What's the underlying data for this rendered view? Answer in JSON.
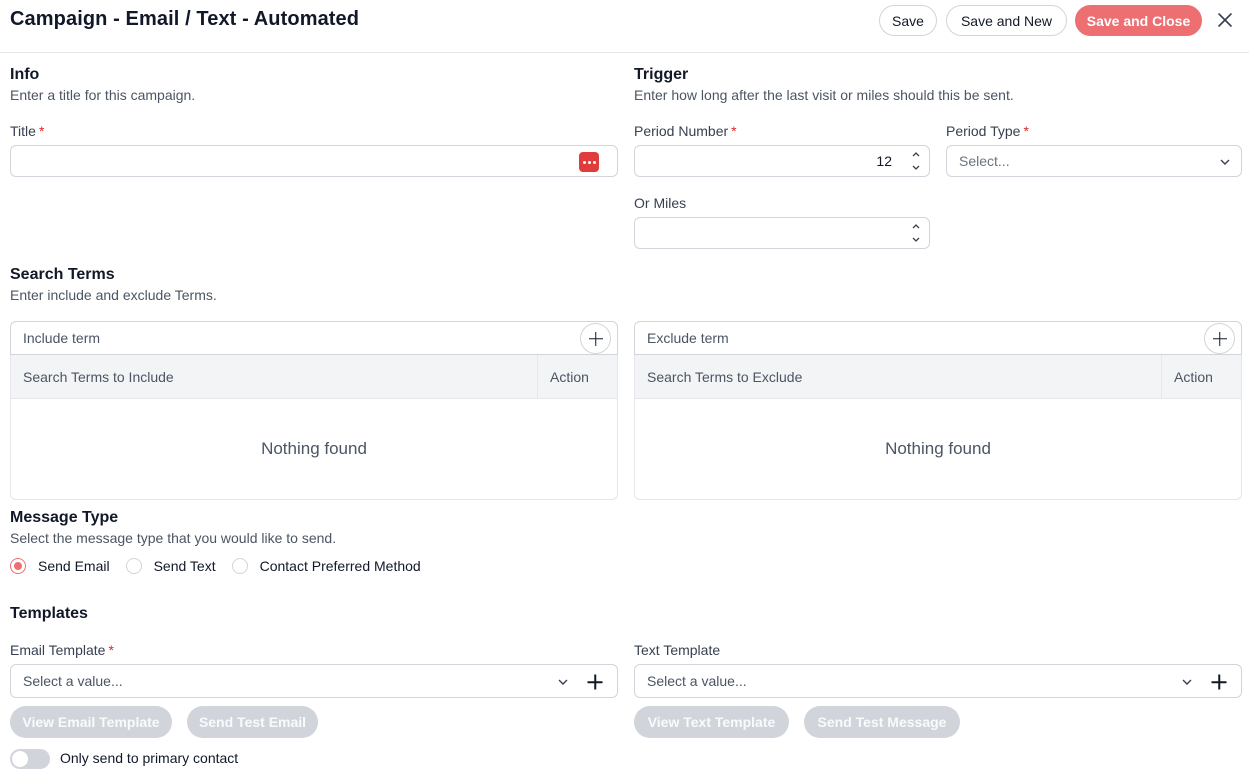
{
  "header": {
    "title": "Campaign - Email / Text - Automated",
    "save_label": "Save",
    "save_new_label": "Save and New",
    "save_close_label": "Save and Close",
    "close_icon": "close-icon"
  },
  "info": {
    "title": "Info",
    "description": "Enter a title for this campaign.",
    "title_label": "Title",
    "title_value": ""
  },
  "trigger": {
    "title": "Trigger",
    "description": "Enter how long after the last visit or miles should this be sent.",
    "period_number_label": "Period Number",
    "period_number_value": "12",
    "period_type_label": "Period Type",
    "period_type_placeholder": "Select...",
    "miles_label": "Or Miles",
    "miles_value": ""
  },
  "search_terms": {
    "title": "Search Terms",
    "description": "Enter include and exclude Terms.",
    "include": {
      "placeholder": "Include term",
      "column": "Search Terms to Include",
      "action": "Action",
      "empty": "Nothing found"
    },
    "exclude": {
      "placeholder": "Exclude term",
      "column": "Search Terms to Exclude",
      "action": "Action",
      "empty": "Nothing found"
    }
  },
  "message_type": {
    "title": "Message Type",
    "description": "Select the message type that you would like to send.",
    "options": [
      "Send Email",
      "Send Text",
      "Contact Preferred Method"
    ],
    "selected": "Send Email"
  },
  "templates": {
    "title": "Templates",
    "email_label": "Email Template",
    "email_placeholder": "Select a value...",
    "text_label": "Text Template",
    "text_placeholder": "Select a value...",
    "view_email_label": "View Email Template",
    "send_test_email_label": "Send Test Email",
    "view_text_label": "View Text Template",
    "send_test_message_label": "Send Test Message",
    "primary_contact_label": "Only send to primary contact",
    "primary_contact_on": false
  },
  "colors": {
    "accent": "#ee6f72",
    "required": "#dc2626",
    "disabled_button": "#d1d5db"
  }
}
